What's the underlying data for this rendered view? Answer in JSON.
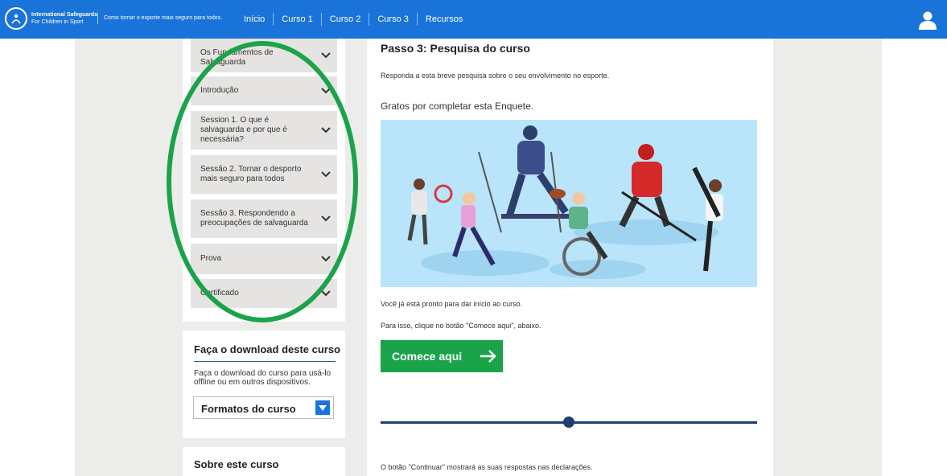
{
  "header": {
    "brand_line1": "International Safeguards",
    "brand_line2": "For Children in Sport",
    "tagline": "Como tornar o esporte mais seguro para todos.",
    "nav": [
      "Início",
      "Curso 1",
      "Curso 2",
      "Curso 3",
      "Recursos"
    ]
  },
  "sidebar": {
    "items": [
      {
        "label": "Os Fundamentos de Salvaguarda"
      },
      {
        "label": "Introdução"
      },
      {
        "label": "Session 1. O que é salvaguarda e por que é necessária?"
      },
      {
        "label": "Sessão 2. Tornar o desporto mais seguro para todos"
      },
      {
        "label": "Sessão 3. Respondendo a preocupações de salvaguarda"
      },
      {
        "label": "Prova"
      },
      {
        "label": "Certificado"
      }
    ]
  },
  "download": {
    "title": "Faça o download deste curso",
    "description": "Faça o download do curso para usá-lo offline ou em outros dispositivos.",
    "select_label": "Formatos do curso"
  },
  "about": {
    "title": "Sobre este curso"
  },
  "main": {
    "step_title": "Passo 3: Pesquisa do curso",
    "intro": "Responda a esta breve pesquisa sobre o seu envolvimento no esporte.",
    "thanks": "Gratos por completar esta Enquete.",
    "ready": "Você já está pronto para dar início ao curso.",
    "click_hint": "Para isso, clique no botão \"Comece aqui\", abaixo.",
    "cta_label": "Comece aqui",
    "continue_hint": "O botão \"Continuar\" mostrará as suas respostas nas declarações.",
    "progress": 0.5
  },
  "colors": {
    "header_bg": "#1a73d9",
    "cta_bg": "#1ba34a",
    "highlight": "#1ba34a",
    "slider": "#1f3f6e"
  },
  "icons": [
    "user-icon",
    "chevron-down-icon",
    "arrow-right-icon",
    "dropdown-arrow-icon"
  ]
}
